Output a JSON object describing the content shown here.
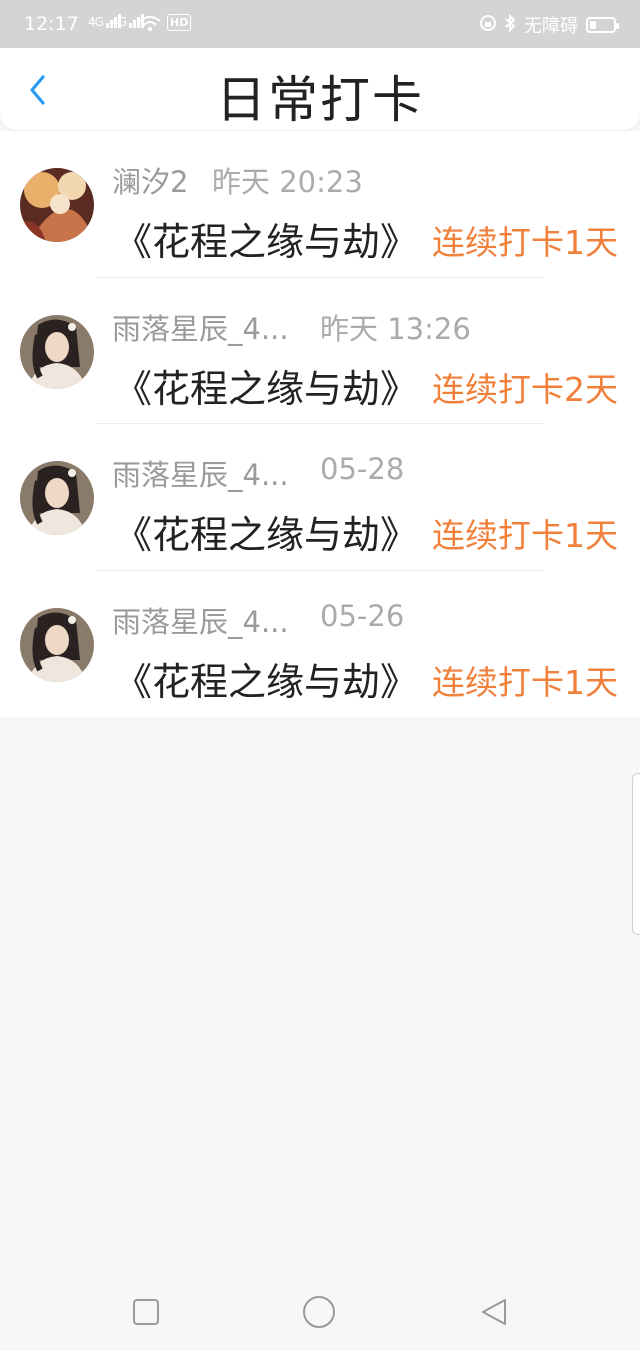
{
  "status_bar": {
    "time": "12:17",
    "net1": "4G",
    "net2": "4G",
    "wifi_icon": "wifi-icon",
    "hd_badge": "HD",
    "accessibility_text": "无障碍"
  },
  "header": {
    "title": "日常打卡",
    "back_icon": "chevron-left-icon",
    "accent_color": "#2a9bf0"
  },
  "checkins": [
    {
      "name": "澜汐2",
      "time": "昨天 20:23",
      "book": "《花程之缘与劫》",
      "streak": "连续打卡1天"
    },
    {
      "name": "雨落星辰_4...",
      "time": "昨天 13:26",
      "book": "《花程之缘与劫》",
      "streak": "连续打卡2天"
    },
    {
      "name": "雨落星辰_4...",
      "time": "05-28",
      "book": "《花程之缘与劫》",
      "streak": "连续打卡1天"
    },
    {
      "name": "雨落星辰_4...",
      "time": "05-26",
      "book": "《花程之缘与劫》",
      "streak": "连续打卡1天"
    }
  ],
  "colors": {
    "streak": "#f0803a",
    "name": "#9a9a9a",
    "background": "#f8f7f8"
  },
  "nav": {
    "recents_icon": "square-icon",
    "home_icon": "circle-icon",
    "back_icon": "triangle-back-icon"
  }
}
